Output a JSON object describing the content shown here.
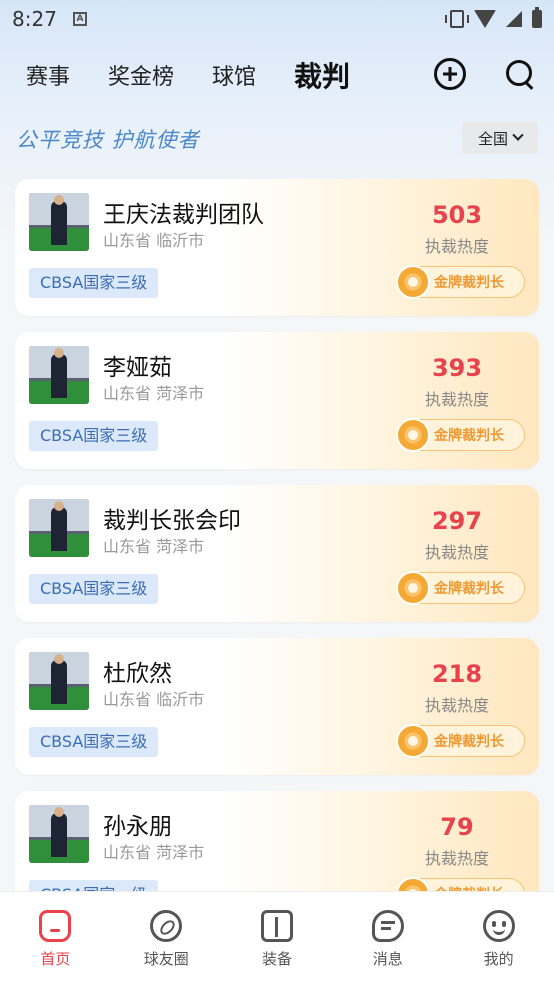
{
  "status_bar": {
    "time": "8:27"
  },
  "header": {
    "tabs": [
      {
        "label": "赛事",
        "active": false
      },
      {
        "label": "奖金榜",
        "active": false
      },
      {
        "label": "球馆",
        "active": false
      },
      {
        "label": "裁判",
        "active": true
      }
    ],
    "icons": [
      "add-icon",
      "search-icon"
    ]
  },
  "slogan": "公平竞技  护航使者",
  "region_select": {
    "value": "全国"
  },
  "referees": [
    {
      "name": "王庆法裁判团队",
      "location": "山东省 临沂市",
      "heat": "503",
      "heat_label": "执裁热度",
      "level": "CBSA国家三级",
      "title": "金牌裁判长"
    },
    {
      "name": "李娅茹",
      "location": "山东省 菏泽市",
      "heat": "393",
      "heat_label": "执裁热度",
      "level": "CBSA国家三级",
      "title": "金牌裁判长"
    },
    {
      "name": "裁判长张会印",
      "location": "山东省 菏泽市",
      "heat": "297",
      "heat_label": "执裁热度",
      "level": "CBSA国家三级",
      "title": "金牌裁判长"
    },
    {
      "name": "杜欣然",
      "location": "山东省 临沂市",
      "heat": "218",
      "heat_label": "执裁热度",
      "level": "CBSA国家三级",
      "title": "金牌裁判长"
    },
    {
      "name": "孙永朋",
      "location": "山东省 菏泽市",
      "heat": "79",
      "heat_label": "执裁热度",
      "level": "CBSA国家一级",
      "title": "金牌裁判长"
    }
  ],
  "bottom_nav": [
    {
      "label": "首页",
      "icon": "home-icon",
      "active": true
    },
    {
      "label": "球友圈",
      "icon": "compass-icon",
      "active": false
    },
    {
      "label": "装备",
      "icon": "box-icon",
      "active": false
    },
    {
      "label": "消息",
      "icon": "chat-icon",
      "active": false
    },
    {
      "label": "我的",
      "icon": "smile-icon",
      "active": false
    }
  ],
  "colors": {
    "accent": "#e8424c",
    "blue": "#4a88c9",
    "gold": "#ec9a33"
  }
}
